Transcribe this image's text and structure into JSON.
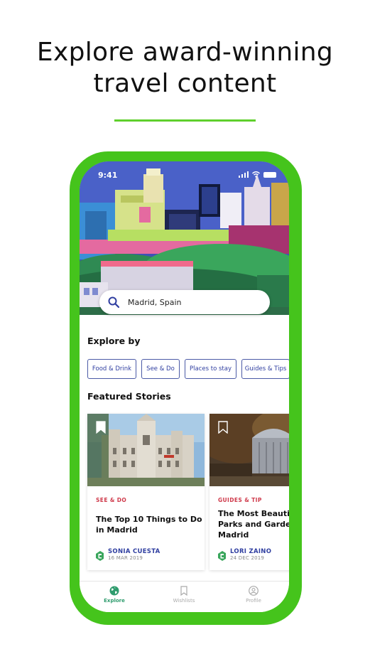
{
  "headline": {
    "line1": "Explore award-winning",
    "line2": "travel content"
  },
  "colors": {
    "phone_frame": "#45c41c",
    "accent_line": "#5fd02c",
    "chip_text": "#2f3ea0",
    "category": "#cf3a4b",
    "active_tab": "#2f9c6e"
  },
  "status_bar": {
    "time": "9:41"
  },
  "search": {
    "value": "Madrid, Spain",
    "icon": "search-icon"
  },
  "explore": {
    "title": "Explore by",
    "chips": [
      "Food & Drink",
      "See & Do",
      "Places to stay",
      "Guides & Tips"
    ]
  },
  "featured": {
    "title": "Featured Stories",
    "stories": [
      {
        "category": "SEE & DO",
        "title": "The Top 10 Things to Do\nin Madrid",
        "author": "SONIA CUESTA",
        "date": "16 MAR 2019"
      },
      {
        "category": "GUIDES & TIP",
        "title": "The Most Beautif\nParks and Garden\nMadrid",
        "author": "LORI ZAINO",
        "date": "24 DEC 2019"
      }
    ]
  },
  "tabs": [
    {
      "label": "Explore",
      "icon": "globe-icon",
      "active": true
    },
    {
      "label": "Wishlists",
      "icon": "bookmark-icon",
      "active": false
    },
    {
      "label": "Profile",
      "icon": "profile-icon",
      "active": false
    }
  ]
}
